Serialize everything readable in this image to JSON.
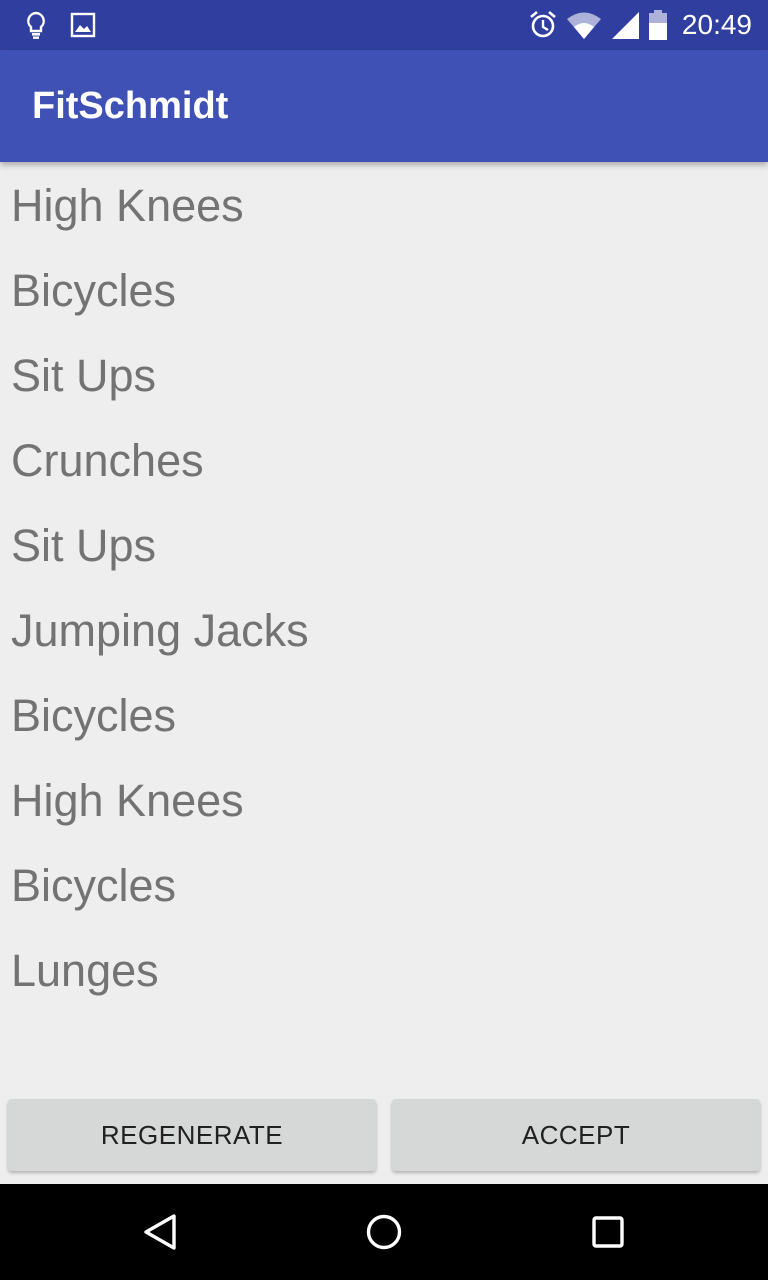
{
  "status_bar": {
    "time": "20:49",
    "left_icons": [
      "lightbulb-icon",
      "image-icon"
    ],
    "right_icons": [
      "alarm-icon",
      "wifi-icon",
      "signal-icon",
      "battery-icon"
    ],
    "background_color": "#303f9f"
  },
  "app_bar": {
    "title": "FitSchmidt",
    "background_color": "#3f51b5"
  },
  "exercises": [
    "High Knees",
    "Bicycles",
    "Sit Ups",
    "Crunches",
    "Sit Ups",
    "Jumping Jacks",
    "Bicycles",
    "High Knees",
    "Bicycles",
    "Lunges"
  ],
  "actions": {
    "regenerate_label": "REGENERATE",
    "accept_label": "ACCEPT"
  },
  "nav_bar": {
    "icons": [
      "back-icon",
      "home-icon",
      "recent-apps-icon"
    ]
  }
}
